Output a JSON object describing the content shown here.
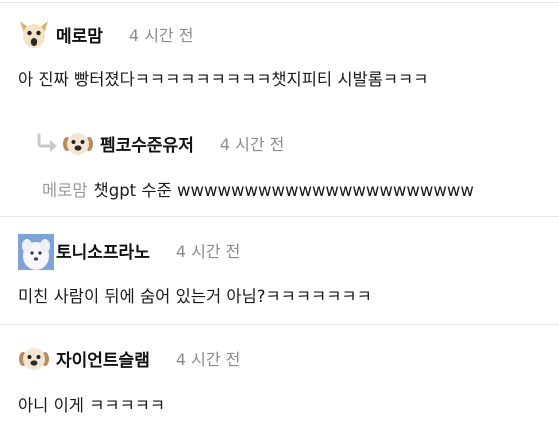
{
  "comments": [
    {
      "nickname": "메로맘",
      "time": "4 시간 전",
      "text": "아 진짜 빵터졌다ㅋㅋㅋㅋㅋㅋㅋㅋㅋ챗지피티 시발롬ㅋㅋㅋ",
      "avatar": "dog-face-icon"
    },
    {
      "nickname": "펨코수준유저",
      "time": "4 시간 전",
      "mention": "메로맘",
      "text": "챗gpt 수준 wwwwwwwwwwwwwwwwwwwwww",
      "avatar": "puppy-face-icon",
      "reply_icon": "reply-arrow-icon"
    },
    {
      "nickname": "토니소프라노",
      "time": "4 시간 전",
      "text": "미친 사람이 뒤에 숨어 있는거 아님?ㅋㅋㅋㅋㅋㅋㅋ",
      "avatar": "white-dog-photo-icon"
    },
    {
      "nickname": "자이언트슬램",
      "time": "4 시간 전",
      "text": "아니 이게 ㅋㅋㅋㅋㅋ",
      "avatar": "puppy-face-icon"
    }
  ],
  "colors": {
    "timestamp": "#8b8b8b",
    "mention": "#9a9a9a",
    "divider": "#e6e6e6",
    "reply_arrow": "#c9c9c9"
  }
}
